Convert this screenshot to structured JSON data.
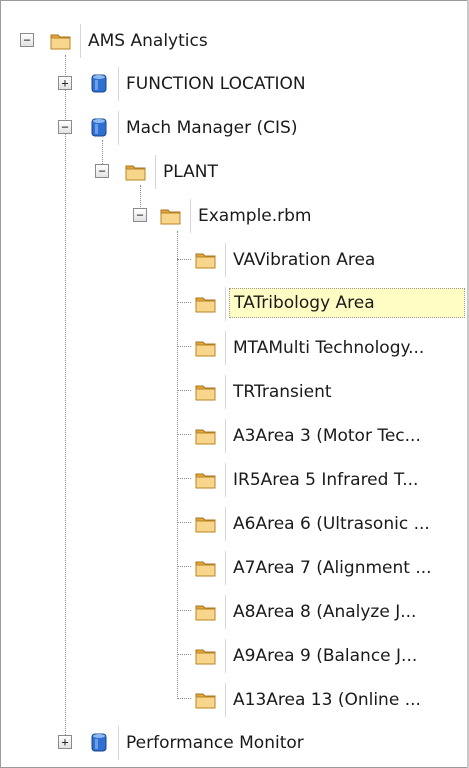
{
  "tree": {
    "root": {
      "label": "AMS Analytics",
      "icon": "folder-icon",
      "expanded": true
    },
    "function_location": {
      "label": "FUNCTION LOCATION",
      "icon": "database-icon",
      "expanded": false
    },
    "mach_manager": {
      "label": "Mach Manager (CIS)",
      "icon": "database-icon",
      "expanded": true
    },
    "plant": {
      "label": "PLANT",
      "icon": "folder-icon",
      "expanded": true
    },
    "example": {
      "label": "Example.rbm",
      "icon": "folder-icon",
      "expanded": true
    },
    "areas": [
      {
        "label": "VAVibration Area",
        "icon": "folder-icon"
      },
      {
        "label": "TATribology Area",
        "icon": "folder-icon",
        "selected": true
      },
      {
        "label": "MTAMulti Technology...",
        "icon": "folder-icon"
      },
      {
        "label": "TRTransient",
        "icon": "folder-icon"
      },
      {
        "label": "A3Area 3 (Motor Tec...",
        "icon": "folder-icon"
      },
      {
        "label": "IR5Area 5 Infrared T...",
        "icon": "folder-icon"
      },
      {
        "label": "A6Area 6 (Ultrasonic ...",
        "icon": "folder-icon"
      },
      {
        "label": "A7Area 7 (Alignment ...",
        "icon": "folder-icon"
      },
      {
        "label": "A8Area 8 (Analyze J...",
        "icon": "folder-icon"
      },
      {
        "label": "A9Area 9 (Balance J...",
        "icon": "folder-icon"
      },
      {
        "label": "A13Area 13 (Online ...",
        "icon": "folder-icon"
      }
    ],
    "performance_monitor": {
      "label": "Performance Monitor",
      "icon": "database-icon",
      "expanded": false
    },
    "toggle_symbols": {
      "expanded": "−",
      "collapsed": "+"
    }
  },
  "colors": {
    "folder": "#f2c96b",
    "database": "#2f6fd0",
    "selection": "#fffcc4",
    "connector": "#8c8c8c"
  }
}
